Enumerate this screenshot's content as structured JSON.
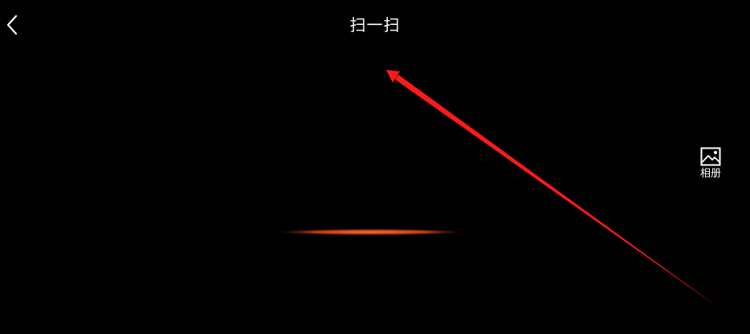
{
  "header": {
    "title": "扫一扫",
    "back_icon": "chevron-left-icon"
  },
  "side_actions": {
    "album_label": "相册",
    "album_icon": "image-icon"
  },
  "scanner": {
    "line_color": "#e0461e"
  },
  "annotation": {
    "arrow_color": "#ff1a1a"
  }
}
